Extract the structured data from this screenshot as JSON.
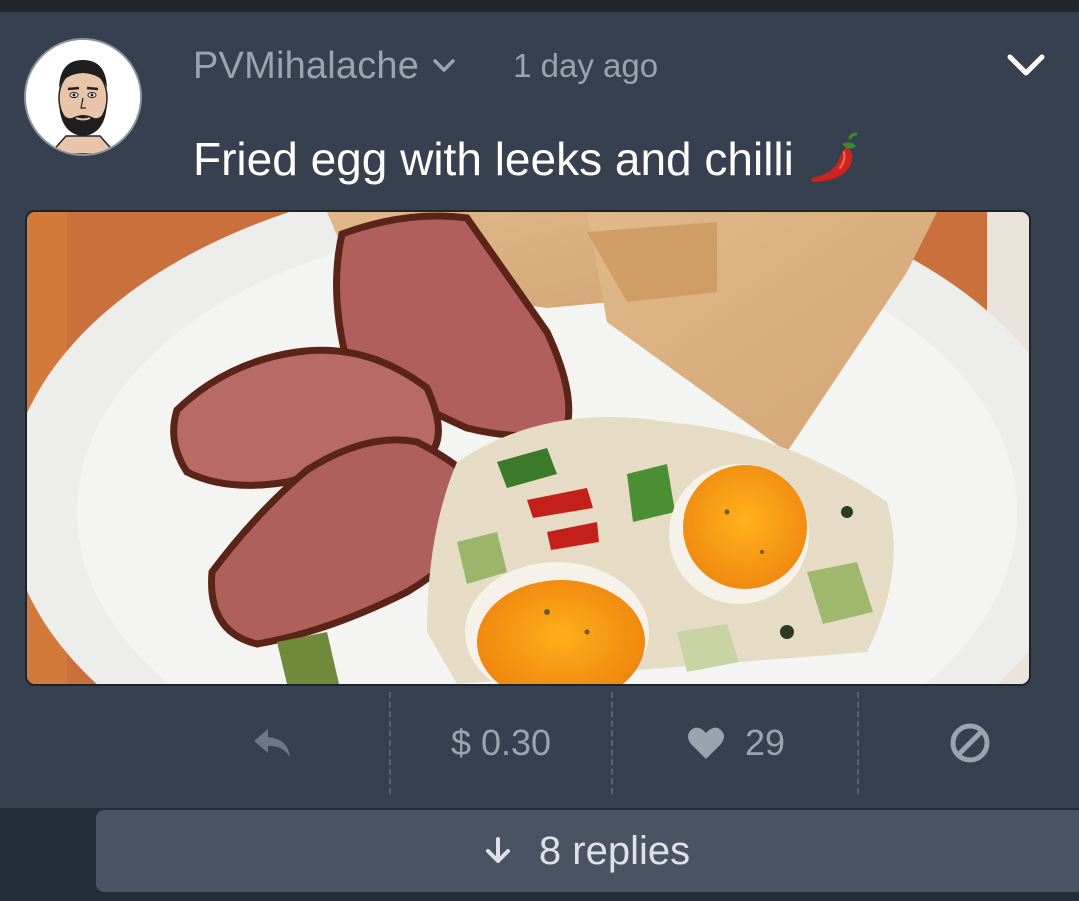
{
  "post": {
    "author": "PVMihalache",
    "time": "1 day ago",
    "title": "Fried egg with leeks and chilli",
    "title_emoji_icon": "chili-pepper-icon"
  },
  "actions": {
    "reply_icon": "reply-icon",
    "payout": "$ 0.30",
    "likes": "29",
    "like_icon": "heart-icon",
    "mute_icon": "block-icon"
  },
  "replies": {
    "label": "8 replies",
    "icon": "arrow-down-icon"
  },
  "colors": {
    "background": "#252d38",
    "card": "#37404e",
    "muted_text": "#9aa3ae",
    "replies_bar": "#4a5361"
  }
}
